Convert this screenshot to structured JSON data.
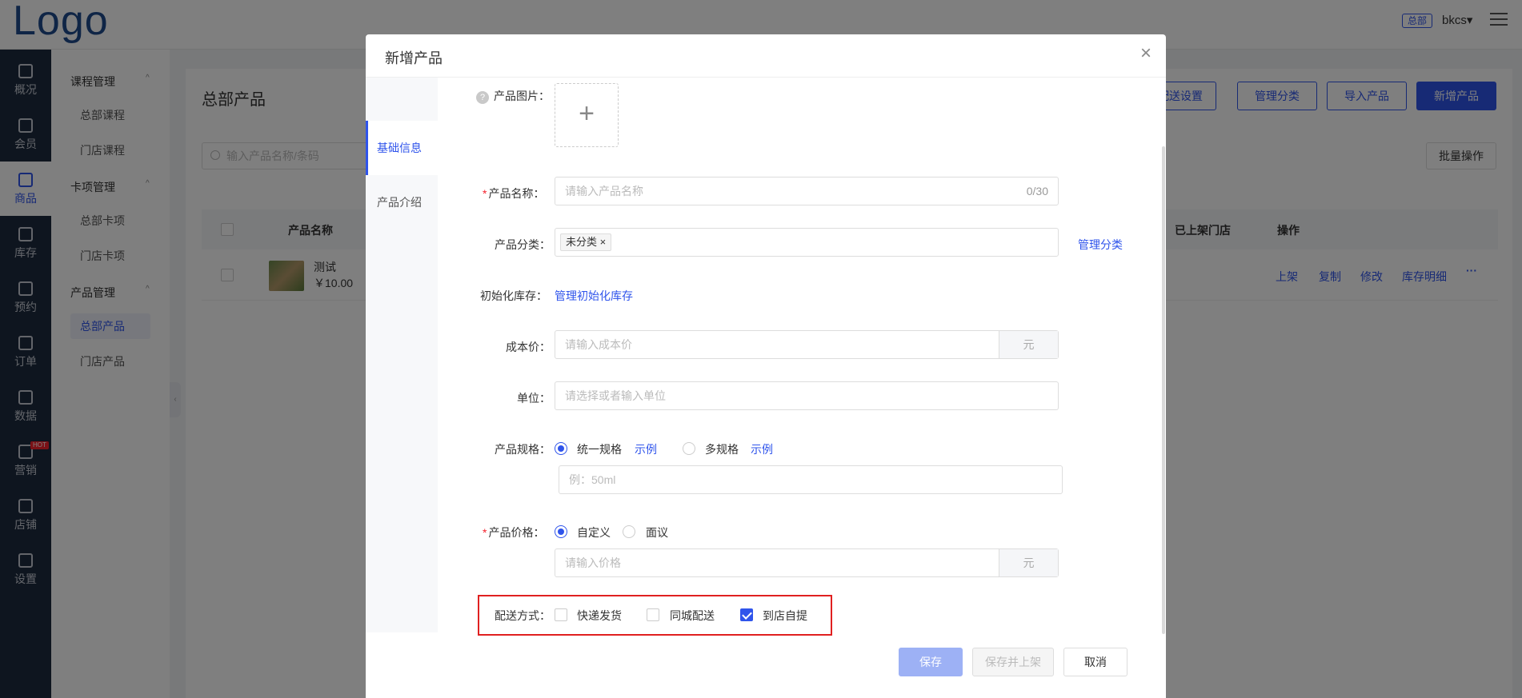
{
  "topbar": {
    "logo": "Logo",
    "badge": "总部",
    "user": "bkcs▾"
  },
  "sidebar": {
    "items": [
      {
        "label": "概况",
        "icon": "grid-icon"
      },
      {
        "label": "会员",
        "icon": "crown-icon"
      },
      {
        "label": "商品",
        "icon": "shop-icon"
      },
      {
        "label": "库存",
        "icon": "box-icon"
      },
      {
        "label": "预约",
        "icon": "calendar-icon"
      },
      {
        "label": "订单",
        "icon": "order-icon"
      },
      {
        "label": "数据",
        "icon": "chart-icon"
      },
      {
        "label": "营销",
        "icon": "gift-icon"
      },
      {
        "label": "店铺",
        "icon": "store-icon"
      },
      {
        "label": "设置",
        "icon": "gear-icon"
      }
    ],
    "hot_badge": "HOT"
  },
  "subnav": {
    "groups": [
      {
        "label": "课程管理",
        "items": [
          "总部课程",
          "门店课程"
        ]
      },
      {
        "label": "卡项管理",
        "items": [
          "总部卡项",
          "门店卡项"
        ]
      },
      {
        "label": "产品管理",
        "items": [
          "总部产品",
          "门店产品"
        ]
      }
    ]
  },
  "page": {
    "title": "总部产品",
    "buttons": [
      "配送设置",
      "管理分类",
      "导入产品",
      "新增产品"
    ],
    "search_placeholder": "输入产品名称/条码",
    "batch": "批量操作",
    "columns": {
      "name": "产品名称",
      "stores": "已上架门店",
      "ops": "操作"
    },
    "row": {
      "name": "测试",
      "price": "￥10.00",
      "ops": [
        "上架",
        "复制",
        "修改",
        "库存明细"
      ],
      "more": "···"
    }
  },
  "modal": {
    "title": "新增产品",
    "close": "×",
    "tabs": [
      "基础信息",
      "产品介绍"
    ],
    "form": {
      "image_label": "产品图片：",
      "upload_plus": "+",
      "name_label": "产品名称：",
      "name_placeholder": "请输入产品名称",
      "name_counter": "0/30",
      "category_label": "产品分类：",
      "category_tag": "未分类 ×",
      "manage_category": "管理分类",
      "init_stock_label": "初始化库存：",
      "manage_init_stock": "管理初始化库存",
      "cost_label": "成本价：",
      "cost_placeholder": "请输入成本价",
      "yuan": "元",
      "unit_label": "单位：",
      "unit_placeholder": "请选择或者输入单位",
      "spec_label": "产品规格：",
      "spec_single": "统一规格",
      "spec_multi": "多规格",
      "example": "示例",
      "spec_placeholder": "例：50ml",
      "price_label": "产品价格：",
      "price_custom": "自定义",
      "price_negotiable": "面议",
      "price_placeholder": "请输入价格",
      "delivery_label": "配送方式：",
      "delivery_express": "快递发货",
      "delivery_local": "同城配送",
      "delivery_pickup": "到店自提"
    },
    "footer": {
      "save": "保存",
      "save_shelf": "保存并上架",
      "cancel": "取消"
    }
  }
}
